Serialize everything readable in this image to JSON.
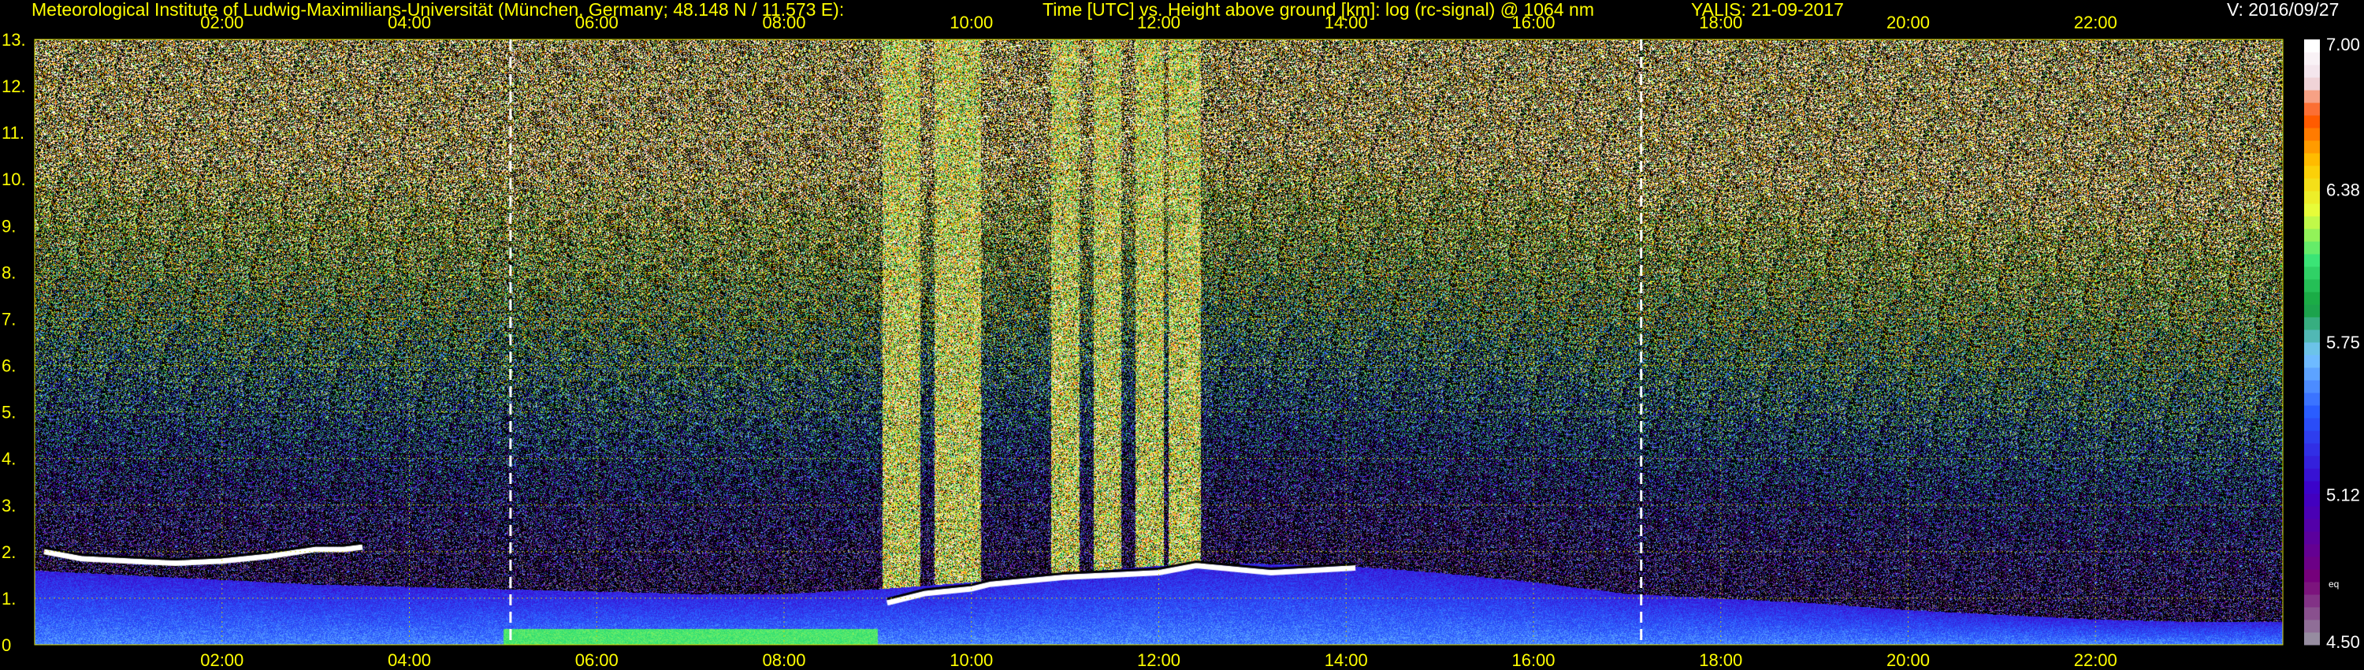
{
  "header": {
    "institute": "Meteorological Institute of Ludwig-Maximilians-Universität (München, Germany; 48.148 N / 11.573 E):",
    "plot_description": "Time [UTC] vs. Height above ground [km]: log (rc-signal) @ 1064 nm",
    "instrument_date": "YALIS: 21-09-2017",
    "version": "V: 2016/09/27"
  },
  "colors": {
    "background": "#000000",
    "header_text": "#ffff00",
    "version_text": "#ffffff",
    "grid": "#d8d800",
    "marker": "#ffffff"
  },
  "chart_data": {
    "type": "heatmap",
    "xlabel": "Time [UTC]",
    "ylabel": "Height above ground [km]",
    "quantity": "log (rc-signal) @ 1064 nm",
    "xlim": [
      0,
      24
    ],
    "ylim": [
      0,
      13
    ],
    "x_ticks": [
      2,
      4,
      6,
      8,
      10,
      12,
      14,
      16,
      18,
      20,
      22
    ],
    "x_tick_labels": [
      "02:00",
      "04:00",
      "06:00",
      "08:00",
      "10:00",
      "12:00",
      "14:00",
      "16:00",
      "18:00",
      "20:00",
      "22:00"
    ],
    "y_ticks": [
      0,
      1,
      2,
      3,
      4,
      5,
      6,
      7,
      8,
      9,
      10,
      11,
      12,
      13
    ],
    "y_tick_labels": [
      "0",
      "1.",
      "2.",
      "3.",
      "4.",
      "5.",
      "6.",
      "7.",
      "8.",
      "9.",
      "10.",
      "11.",
      "12.",
      "13."
    ],
    "grid": true,
    "marker_times": [
      5.08,
      17.15
    ],
    "colorbar": {
      "range": [
        4.5,
        7.0
      ],
      "ticks": [
        4.5,
        5.12,
        5.75,
        6.38,
        7.0
      ],
      "tick_labels": [
        "4.50",
        "5.12",
        "5.75",
        "6.38",
        "7.00"
      ],
      "eq_label": "eq"
    },
    "boundary_layer_top": {
      "time": [
        0,
        1,
        2,
        3,
        4,
        5,
        6,
        7,
        8,
        9,
        10,
        11,
        12,
        13,
        14,
        15,
        16,
        17,
        18,
        19,
        20,
        21,
        22,
        23,
        24
      ],
      "height": [
        1.6,
        1.5,
        1.4,
        1.3,
        1.25,
        1.2,
        1.15,
        1.1,
        1.1,
        1.2,
        1.35,
        1.55,
        1.7,
        1.75,
        1.7,
        1.55,
        1.35,
        1.1,
        1.0,
        0.9,
        0.75,
        0.65,
        0.55,
        0.5,
        0.5
      ]
    },
    "cloud_layer": {
      "time": [
        0.1,
        0.5,
        1.0,
        1.5,
        2.0,
        2.5,
        3.0,
        3.3,
        3.5,
        9.1,
        9.5,
        10.0,
        10.2,
        11.0,
        11.5,
        12.0,
        12.4,
        13.2,
        14.1
      ],
      "height": [
        2.0,
        1.85,
        1.8,
        1.75,
        1.8,
        1.9,
        2.05,
        2.05,
        2.1,
        0.9,
        1.1,
        1.2,
        1.3,
        1.45,
        1.5,
        1.55,
        1.7,
        1.55,
        1.65
      ]
    },
    "precip_fall_streaks": [
      {
        "start": 9.05,
        "end": 9.45
      },
      {
        "start": 9.6,
        "end": 10.1
      },
      {
        "start": 10.85,
        "end": 11.15
      },
      {
        "start": 11.3,
        "end": 11.6
      },
      {
        "start": 11.75,
        "end": 12.05
      },
      {
        "start": 12.1,
        "end": 12.45
      }
    ]
  }
}
